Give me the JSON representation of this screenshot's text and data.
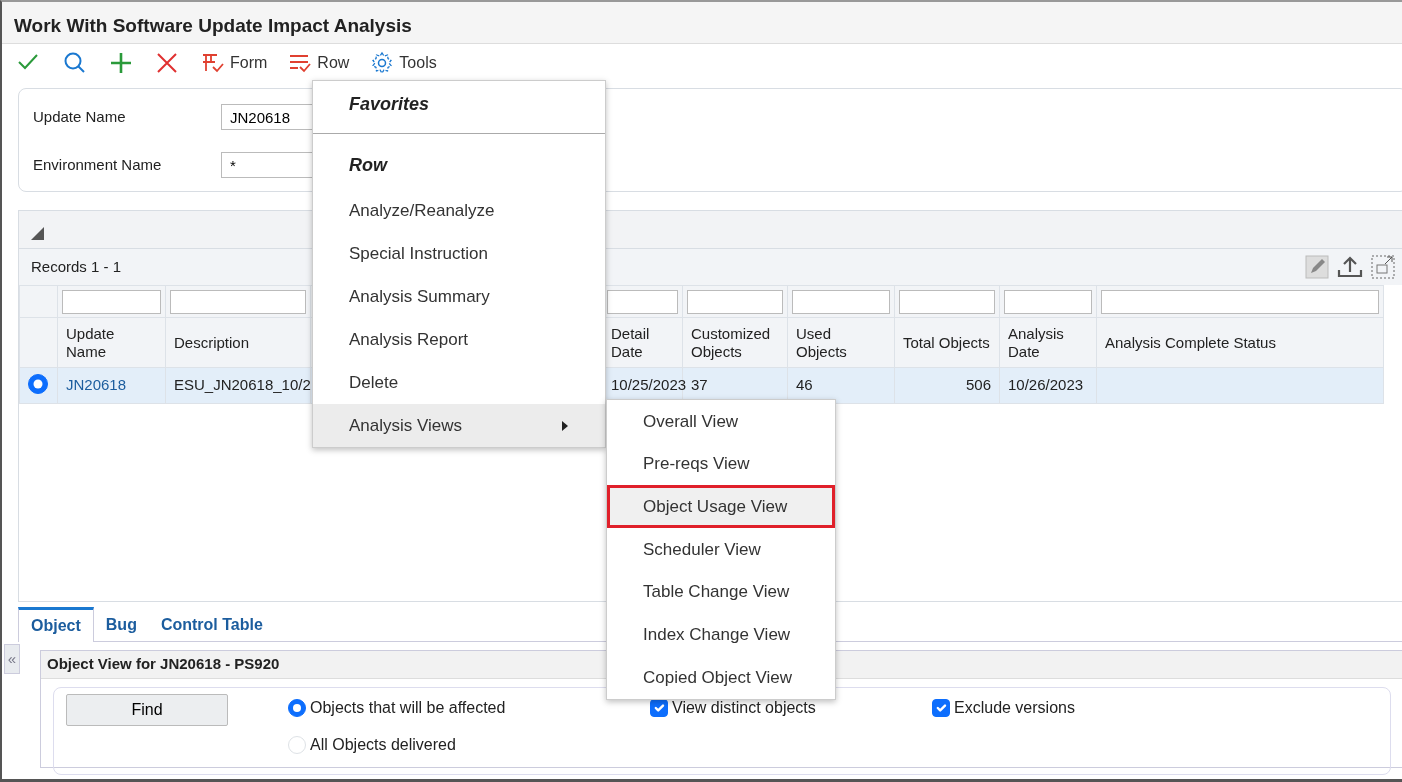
{
  "window": {
    "title": "Work With Software Update Impact Analysis"
  },
  "toolbar": [
    {
      "kind": "check"
    },
    {
      "kind": "search"
    },
    {
      "kind": "add"
    },
    {
      "kind": "delete"
    },
    {
      "kind": "form",
      "label": "Form"
    },
    {
      "kind": "row",
      "label": "Row"
    },
    {
      "kind": "tools",
      "label": "Tools"
    }
  ],
  "filters": [
    {
      "label": "Update Name",
      "value": "JN20618"
    },
    {
      "label": "Environment Name",
      "value": "*"
    }
  ],
  "grid": {
    "records": "Records 1 - 1",
    "columns": [
      {
        "label": "Update Name",
        "kind": "text"
      },
      {
        "label": "Description",
        "kind": "text"
      },
      {
        "kind": "hidden"
      },
      {
        "kind": "hidden"
      },
      {
        "label": "Detail Date",
        "kind": "text"
      },
      {
        "label": "Customized Objects",
        "kind": "text"
      },
      {
        "label": "Used Objects",
        "kind": "text"
      },
      {
        "label": "Total Objects",
        "kind": "number"
      },
      {
        "label": "Analysis Date",
        "kind": "text"
      },
      {
        "label": "Analysis Complete Status",
        "kind": "text"
      }
    ],
    "rows": [
      {
        "selected": true,
        "cells": [
          "JN20618",
          "ESU_JN20618_10/2",
          "",
          "",
          "10/25/2023",
          "37",
          "46",
          "506",
          "10/26/2023",
          ""
        ]
      }
    ]
  },
  "row_menu": {
    "sections": [
      {
        "title": "Favorites"
      },
      {
        "title": "Row",
        "items": [
          {
            "label": "Analyze/Reanalyze",
            "expanded": false
          },
          {
            "label": "Special Instruction",
            "expanded": false
          },
          {
            "label": "Analysis Summary",
            "expanded": false
          },
          {
            "label": "Analysis Report",
            "expanded": false
          },
          {
            "label": "Delete",
            "expanded": false
          },
          {
            "label": "Analysis Views",
            "expanded": true,
            "submenu": [
              {
                "label": "Overall View",
                "selected": false
              },
              {
                "label": "Pre-reqs View",
                "selected": false
              },
              {
                "label": "Object Usage View",
                "selected": true
              },
              {
                "label": "Scheduler View",
                "selected": false
              },
              {
                "label": "Table Change View",
                "selected": false
              },
              {
                "label": "Index Change View",
                "selected": false
              },
              {
                "label": "Copied Object View",
                "selected": false
              }
            ]
          }
        ]
      }
    ]
  },
  "collapse_button": "«",
  "tabs": [
    {
      "label": "Object",
      "selected": true
    },
    {
      "label": "Bug",
      "selected": false
    },
    {
      "label": "Control Table",
      "selected": false
    }
  ],
  "panel": {
    "title": "Object View for JN20618 - PS920",
    "find_button": "Find",
    "options": [
      {
        "label": "Objects that will be affected",
        "selected": true
      },
      {
        "label": "All Objects delivered",
        "selected": false
      }
    ],
    "checkboxes": [
      {
        "label": "View distinct objects",
        "checked": true
      },
      {
        "label": "Exclude versions",
        "checked": true
      }
    ]
  }
}
